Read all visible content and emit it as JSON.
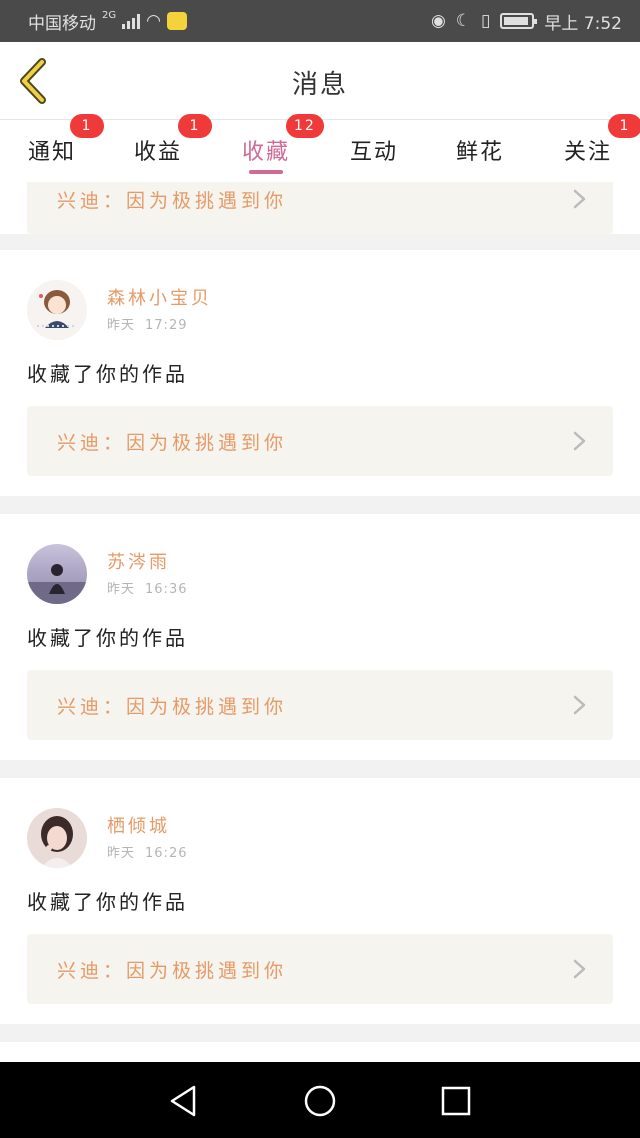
{
  "status_bar": {
    "carrier": "中国移动",
    "network": "2G",
    "time": "早上 7:52"
  },
  "header": {
    "title": "消息",
    "back_icon": "chevron-left-icon"
  },
  "tabs": [
    {
      "label": "通知",
      "badge": "1",
      "active": false
    },
    {
      "label": "收益",
      "badge": "1",
      "active": false
    },
    {
      "label": "收藏",
      "badge": "12",
      "active": true
    },
    {
      "label": "互动",
      "badge": "",
      "active": false
    },
    {
      "label": "鲜花",
      "badge": "",
      "active": false
    },
    {
      "label": "关注",
      "badge": "1",
      "active": false
    }
  ],
  "partial_card": {
    "work_text": "兴迪：因为极挑遇到你"
  },
  "messages": [
    {
      "name": "森林小宝贝",
      "day": "昨天",
      "time": "17:29",
      "action": "收藏了你的作品",
      "work_text": "兴迪：因为极挑遇到你"
    },
    {
      "name": "苏涔雨",
      "day": "昨天",
      "time": "16:36",
      "action": "收藏了你的作品",
      "work_text": "兴迪：因为极挑遇到你"
    },
    {
      "name": "栖倾城",
      "day": "昨天",
      "time": "16:26",
      "action": "收藏了你的作品",
      "work_text": "兴迪：因为极挑遇到你"
    }
  ],
  "colors": {
    "accent_pink": "#d06a97",
    "name_orange": "#e79a66",
    "badge_red": "#f03a3a",
    "back_arrow_yellow": "#f2cf4a"
  },
  "icons": [
    "chevron-left-icon",
    "chevron-right-icon",
    "nav-back-icon",
    "nav-home-icon",
    "nav-recents-icon"
  ]
}
